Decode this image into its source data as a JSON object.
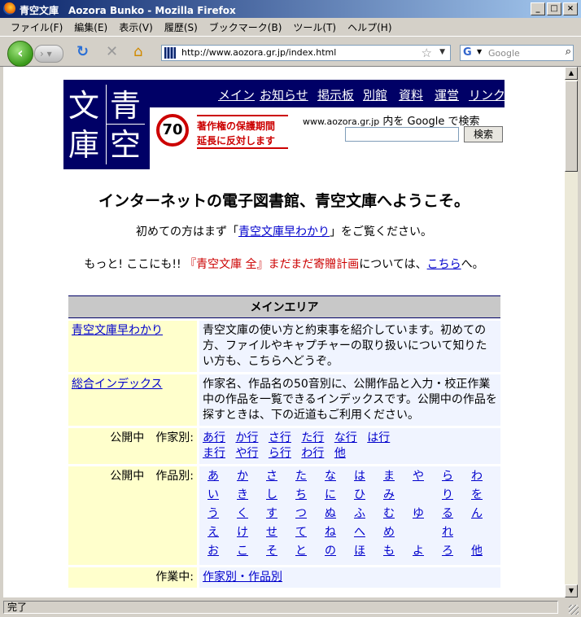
{
  "window": {
    "title": "青空文庫　Aozora Bunko - Mozilla Firefox",
    "controls": [
      "_",
      "□",
      "×"
    ]
  },
  "menu": [
    "ファイル(F)",
    "編集(E)",
    "表示(V)",
    "履歴(S)",
    "ブックマーク(B)",
    "ツール(T)",
    "ヘルプ(H)"
  ],
  "toolbar": {
    "url": "http://www.aozora.gr.jp/index.html",
    "search_placeholder": "Google"
  },
  "site": {
    "logo": [
      "文",
      "青",
      "庫",
      "空"
    ],
    "nav": [
      "メイン",
      "お知らせ",
      "掲示板",
      "別館",
      "資料",
      "運営",
      "リンク"
    ],
    "banner": {
      "number": "70",
      "line1": "著作権の保護期間",
      "line2": "延長に反対します"
    },
    "gsearch": {
      "site": "www.aozora.gr.jp",
      "mid": " 内を Google で検索",
      "button": "検索"
    }
  },
  "headline": "インターネットの電子図書館、青空文庫へようこそ。",
  "intro1": {
    "pre": "初めての方はまず「",
    "link": "青空文庫早わかり",
    "post": "」をご覧ください。"
  },
  "intro2": {
    "pre": "もっと! ここにも!! ",
    "red": "『青空文庫 全』まだまだ寄贈計画",
    "mid": "については、",
    "link": "こちら",
    "post": "へ。"
  },
  "main": {
    "header": "メインエリア",
    "rows": [
      {
        "label": "青空文庫早わかり",
        "desc": "青空文庫の使い方と約束事を紹介しています。初めての方、ファイルやキャプチャーの取り扱いについて知りたい方も、こちらへどうぞ。"
      },
      {
        "label": "総合インデックス",
        "desc": "作家名、作品名の50音別に、公開作品と入力・校正作業中の作品を一覧できるインデックスです。公開中の作品を探すときは、下の近道もご利用ください。"
      }
    ],
    "authors": {
      "label": "公開中　作家別:",
      "line1": [
        "あ行",
        "か行",
        "さ行",
        "た行",
        "な行",
        "は行"
      ],
      "line2": [
        "ま行",
        "や行",
        "ら行",
        "わ行",
        "他"
      ]
    },
    "works": {
      "label": "公開中　作品別:",
      "grid": [
        [
          "あ",
          "か",
          "さ",
          "た",
          "な",
          "は",
          "ま",
          "や",
          "ら",
          "わ"
        ],
        [
          "い",
          "き",
          "し",
          "ち",
          "に",
          "ひ",
          "み",
          "",
          "り",
          "を"
        ],
        [
          "う",
          "く",
          "す",
          "つ",
          "ぬ",
          "ふ",
          "む",
          "ゆ",
          "る",
          "ん"
        ],
        [
          "え",
          "け",
          "せ",
          "て",
          "ね",
          "へ",
          "め",
          "",
          "れ",
          ""
        ],
        [
          "お",
          "こ",
          "そ",
          "と",
          "の",
          "ほ",
          "も",
          "よ",
          "ろ",
          "他"
        ]
      ]
    },
    "working": {
      "label": "作業中:",
      "link": "作家別・作品別"
    }
  },
  "status": "完了"
}
